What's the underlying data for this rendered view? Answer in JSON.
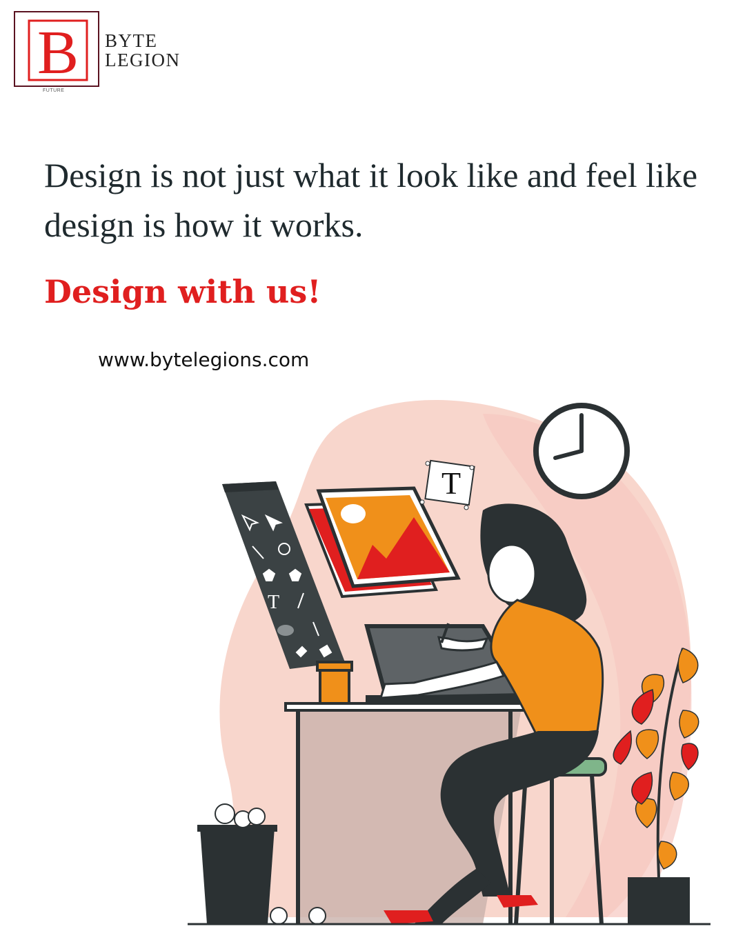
{
  "brand": {
    "logo_letter": "B",
    "logo_tagline": "FUTURE",
    "name_line1": "BYTE",
    "name_line2": "LEGION"
  },
  "headline": {
    "quote": "Design is not just what it look like and feel like design is how it works.",
    "cta": "Design with us!",
    "website": "www.bytelegions.com"
  },
  "illustration": {
    "text_tool_glyph": "T"
  },
  "colors": {
    "accent_red": "#e01f1f",
    "orange": "#f0901a",
    "dark": "#2b3133",
    "blob_pink": "#f8d6cc",
    "stool_green": "#7fb58a"
  }
}
